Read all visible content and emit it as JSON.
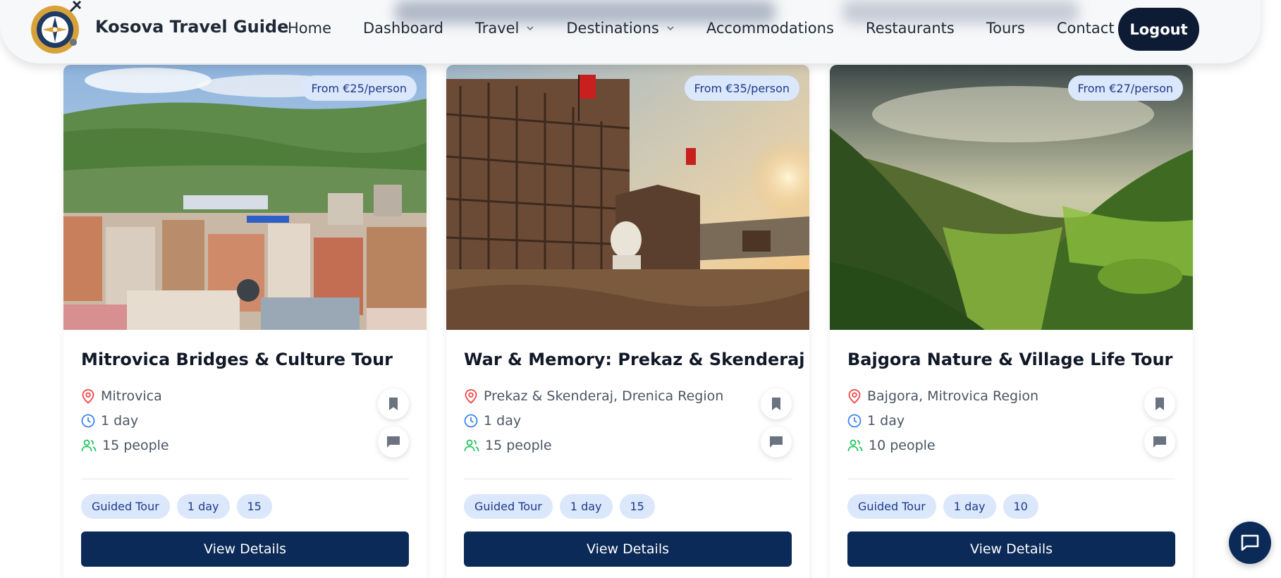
{
  "header": {
    "brand": "Kosova Travel Guide",
    "logo_icon": "compass-logo-icon",
    "nav": [
      {
        "label": "Home",
        "dropdown": false
      },
      {
        "label": "Dashboard",
        "dropdown": false
      },
      {
        "label": "Travel",
        "dropdown": true
      },
      {
        "label": "Destinations",
        "dropdown": true
      },
      {
        "label": "Accommodations",
        "dropdown": false
      },
      {
        "label": "Restaurants",
        "dropdown": false
      },
      {
        "label": "Tours",
        "dropdown": false
      },
      {
        "label": "Contact",
        "dropdown": false
      }
    ],
    "logout_label": "Logout"
  },
  "tours": [
    {
      "title": "Mitrovica Bridges & Culture Tour",
      "price": "From €25/person",
      "location": "Mitrovica",
      "duration": "1 day",
      "people": "15 people",
      "tags": [
        "Guided Tour",
        "1 day",
        "15"
      ],
      "button_label": "View Details",
      "image": "city-panorama-photo"
    },
    {
      "title": "War & Memory: Prekaz & Skenderaj",
      "price": "From €35/person",
      "location": "Prekaz & Skenderaj, Drenica Region",
      "duration": "1 day",
      "people": "15 people",
      "tags": [
        "Guided Tour",
        "1 day",
        "15"
      ],
      "button_label": "View Details",
      "image": "memorial-complex-photo"
    },
    {
      "title": "Bajgora Nature & Village Life Tour",
      "price": "From €27/person",
      "location": "Bajgora, Mitrovica Region",
      "duration": "1 day",
      "people": "10 people",
      "tags": [
        "Guided Tour",
        "1 day",
        "10"
      ],
      "button_label": "View Details",
      "image": "green-valley-photo"
    }
  ],
  "icons": {
    "location": "map-pin-icon",
    "duration": "clock-icon",
    "people": "users-icon",
    "bookmark": "bookmark-icon",
    "comment": "comment-icon",
    "chat": "chat-icon"
  },
  "colors": {
    "primary": "#0b2a57",
    "logout_bg": "#0d1b34",
    "badge_bg": "#dbe7fb",
    "badge_text": "#1e3a8a",
    "pin": "#ef4444",
    "clock": "#3b82f6",
    "users": "#22c55e"
  }
}
